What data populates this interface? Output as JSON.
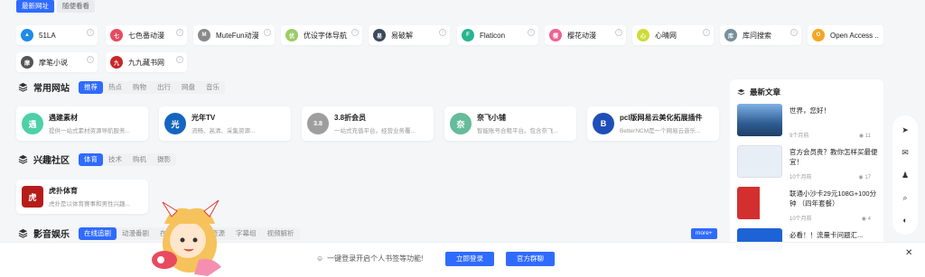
{
  "top_tabs": [
    "最新网址",
    "随便看看"
  ],
  "quick_links": [
    {
      "name": "51LA",
      "color": "#1e8ce8",
      "glyph": "▲"
    },
    {
      "name": "七色番动漫",
      "color": "#e84a5f",
      "glyph": "七"
    },
    {
      "name": "MuteFun动漫",
      "color": "#8a8a8a",
      "glyph": "M"
    },
    {
      "name": "优设字体导航",
      "color": "#9ccc65",
      "glyph": "优"
    },
    {
      "name": "易破解",
      "color": "#3b4a5a",
      "glyph": "易"
    },
    {
      "name": "Flaticon",
      "color": "#27b590",
      "glyph": "F"
    },
    {
      "name": "樱花动漫",
      "color": "#f06292",
      "glyph": "樱"
    },
    {
      "name": "心晴网",
      "color": "#cddc39",
      "glyph": "心"
    },
    {
      "name": "库问搜索",
      "color": "#78909c",
      "glyph": "库"
    },
    {
      "name": "Open Access ...",
      "color": "#f5a623",
      "glyph": "O"
    },
    {
      "name": "摩笔小说",
      "color": "#555555",
      "glyph": "摩"
    },
    {
      "name": "九九藏书网",
      "color": "#c62828",
      "glyph": "九"
    }
  ],
  "sections": [
    {
      "title": "常用网站",
      "tabs": [
        "推荐",
        "热点",
        "购物",
        "出行",
        "网盘",
        "音乐"
      ],
      "cards": [
        {
          "name": "遇建素材",
          "desc": "提供一站式素材资源导航服务...",
          "color": "#4dd0a8",
          "glyph": "遇"
        },
        {
          "name": "光年TV",
          "desc": "流畅、高清、采集资源...",
          "color": "#1565c0",
          "glyph": "光"
        },
        {
          "name": "3.8折会员",
          "desc": "一站式充值平台。经营业务覆...",
          "color": "#9e9e9e",
          "glyph": "3.8"
        },
        {
          "name": "奈飞小铺",
          "desc": "智能账号合租平台。包含奈飞...",
          "color": "#66bb9a",
          "glyph": "奈"
        },
        {
          "name": "pcl版网易云美化拓展插件",
          "desc": "BetterNCM是一个网易云音乐...",
          "color": "#1e4fb8",
          "glyph": "B"
        }
      ]
    },
    {
      "title": "兴趣社区",
      "tabs": [
        "体育",
        "技术",
        "购机",
        "摄影"
      ],
      "cards": [
        {
          "name": "虎扑体育",
          "desc": "虎扑是以体育赛事和男性兴趣...",
          "color": "#b71c1c",
          "glyph": "虎"
        }
      ]
    },
    {
      "title": "影音娱乐",
      "tabs": [
        "在线追剧",
        "动漫番剧",
        "在线直播",
        "影视资源",
        "字幕组",
        "视频解析"
      ],
      "cards": []
    }
  ],
  "more_label": "more+",
  "news": {
    "title": "最新文章",
    "items": [
      {
        "title": "世界，您好！",
        "date": "9个月前",
        "views": "11",
        "thumb": "#3a6fb0"
      },
      {
        "title": "官方会员贵？教你怎样买最便宜！",
        "date": "10个月前",
        "views": "17",
        "thumb": "#e8eef6"
      },
      {
        "title": "联通小沙卡29元108G+100分钟 （四年套餐）",
        "date": "10个月前",
        "views": "4",
        "thumb": "#d32f2f"
      },
      {
        "title": "必看！！流量卡问题汇...",
        "date": "",
        "views": "",
        "thumb": "#1e63d6"
      }
    ]
  },
  "side_tools": [
    "send-icon",
    "wechat-icon",
    "qq-icon",
    "search-icon",
    "theme-icon"
  ],
  "login": {
    "text": "一键登录开启个人书签等功能!",
    "login_btn": "立即登录",
    "group_btn": "官方群聊",
    "close": "✕"
  }
}
